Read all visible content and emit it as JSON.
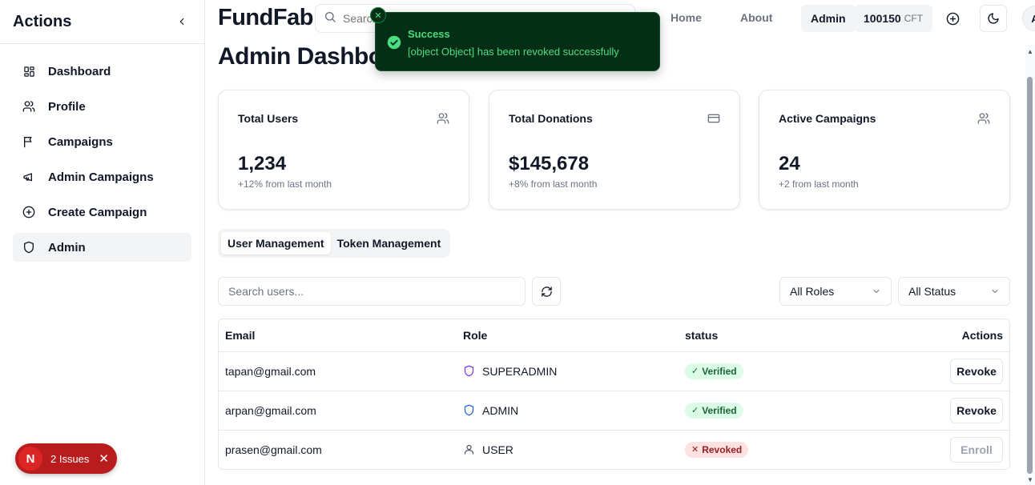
{
  "sidebar": {
    "title": "Actions",
    "items": [
      {
        "label": "Dashboard",
        "icon": "dashboard-grid-icon"
      },
      {
        "label": "Profile",
        "icon": "users-icon"
      },
      {
        "label": "Campaigns",
        "icon": "flag-icon"
      },
      {
        "label": "Admin Campaigns",
        "icon": "megaphone-icon"
      },
      {
        "label": "Create Campaign",
        "icon": "plus-circle-icon"
      },
      {
        "label": "Admin",
        "icon": "shield-icon",
        "active": true
      }
    ]
  },
  "header": {
    "brand": "FundFab",
    "search_placeholder": "Search",
    "nav": {
      "home": "Home",
      "about": "About"
    },
    "admin_label": "Admin",
    "token_balance": "100150",
    "token_unit": "CFT",
    "avatar_initial": "A"
  },
  "main": {
    "title": "Admin Dashboard",
    "cards": [
      {
        "title": "Total Users",
        "value": "1,234",
        "sub": "+12% from last month",
        "icon": "users-icon"
      },
      {
        "title": "Total Donations",
        "value": "$145,678",
        "sub": "+8% from last month",
        "icon": "credit-card-icon"
      },
      {
        "title": "Active Campaigns",
        "value": "24",
        "sub": "+2 from last month",
        "icon": "users-icon"
      }
    ],
    "tabs": [
      "User Management",
      "Token Management"
    ],
    "active_tab": "User Management",
    "search_placeholder": "Search users...",
    "role_filter": "All Roles",
    "status_filter": "All Status",
    "table": {
      "headers": [
        "Email",
        "Role",
        "status",
        "Actions"
      ],
      "rows": [
        {
          "email": "tapan@gmail.com",
          "role": "SUPERADMIN",
          "status": "Verified",
          "action": "Revoke"
        },
        {
          "email": "arpan@gmail.com",
          "role": "ADMIN",
          "status": "Verified",
          "action": "Revoke"
        },
        {
          "email": "prasen@gmail.com",
          "role": "USER",
          "status": "Revoked",
          "action": "Enroll"
        }
      ]
    }
  },
  "toast": {
    "title": "Success",
    "message": "[object Object] has been revoked successfully"
  },
  "issues": {
    "avatar": "N",
    "label": "2 Issues"
  },
  "colors": {
    "toast_bg": "#052e16",
    "toast_text": "#4ade80",
    "verified_bg": "#dcfce7",
    "revoked_bg": "#fee2e2",
    "superadmin": "#7c3aed",
    "admin": "#2563eb",
    "issues_bg": "#b91c1c"
  }
}
